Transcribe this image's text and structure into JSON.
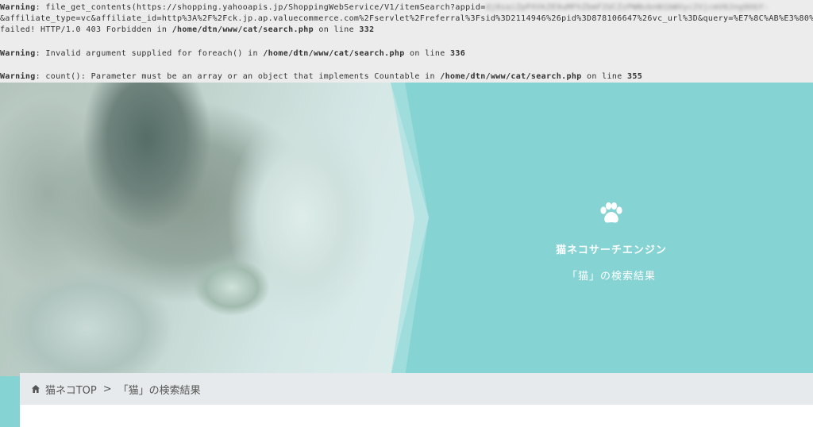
{
  "warnings": [
    {
      "label": "Warning",
      "prefix": ": file_get_contents(https://shopping.yahooapis.jp/ShoppingWebService/V1/itemSearch?appid=",
      "blurred": "dj0zaiZpPXVkZE9uMFhZbmF2UCZzPWNvbnN1bWVyc2VjcmV0Jng9OGY-",
      "line2_prefix": "&affiliate_type=vc&affiliate_id=http%3A%2F%2Fck.jp.ap.valuecommerce.com%2Fservlet%2Freferral%3Fsid%3D2114946%26pid%3D878106647%26vc_url%3D&query=%E7%8C%AB%E3%80%",
      "line3": "failed! HTTP/1.0 403 Forbidden in ",
      "path": "/home/dtn/www/cat/search.php",
      "on_line": " on line ",
      "line": "332"
    },
    {
      "label": "Warning",
      "text": ": Invalid argument supplied for foreach() in ",
      "path": "/home/dtn/www/cat/search.php",
      "on_line": " on line ",
      "line": "336"
    },
    {
      "label": "Warning",
      "text": ": count(): Parameter must be an array or an object that implements Countable in ",
      "path": "/home/dtn/www/cat/search.php",
      "on_line": " on line ",
      "line": "355"
    }
  ],
  "hero": {
    "site_name": "猫ネコサーチエンジン",
    "result_title": "「猫」の検索結果"
  },
  "breadcrumb": {
    "home_label": "猫ネコTOP",
    "separator": ">",
    "current": "「猫」の検索結果"
  },
  "colors": {
    "hero_teal": "#86d3d4",
    "breadcrumb_bg": "#e7eaec",
    "warning_bg": "#ececec"
  },
  "icons": [
    "paw-icon",
    "home-icon"
  ]
}
